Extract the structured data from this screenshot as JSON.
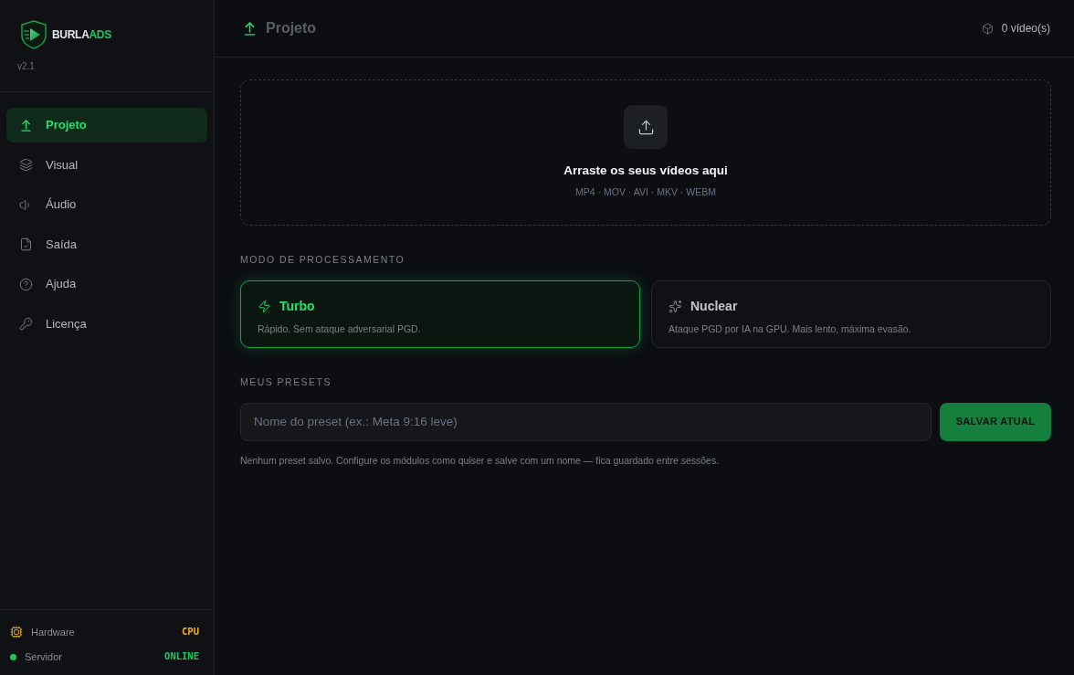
{
  "sidebar": {
    "brand": {
      "name_parts": [
        {
          "text": "BURLA",
          "color": "#e5e7eb"
        },
        {
          "text": "ADS",
          "color": "#22c55e"
        }
      ]
    },
    "version": "v2.1",
    "items": [
      {
        "label": "Projeto",
        "selected": true
      },
      {
        "label": "Visual",
        "selected": false
      },
      {
        "label": "Áudio",
        "selected": false
      },
      {
        "label": "Saída",
        "selected": false
      },
      {
        "label": "Ajuda",
        "selected": false
      },
      {
        "label": "Licença",
        "selected": false
      }
    ],
    "status": [
      {
        "kind": "icon",
        "label": "Hardware",
        "value": "CPU",
        "color": "#f5b324"
      },
      {
        "kind": "dot",
        "label": "Servidor",
        "value": "ONLINE",
        "color": "#22c55e"
      }
    ]
  },
  "header": {
    "title": "Projeto",
    "counter": "0 vídeo(s)"
  },
  "dropzone": {
    "title": "Arraste os seus vídeos aqui",
    "formats": "MP4 · MOV · AVI · MKV · WEBM"
  },
  "processing_mode": {
    "label": "MODO DE PROCESSAMENTO",
    "modes": [
      {
        "title": "Turbo",
        "description": "Rápido. Sem ataque adversarial PGD.",
        "selected": true
      },
      {
        "title": "Nuclear",
        "description": "Ataque PGD por IA na GPU. Mais lento, máxima evasão.",
        "selected": false
      }
    ]
  },
  "presets": {
    "label": "MEUS PRESETS",
    "input": {
      "placeholder": "Nome do preset (ex.: Meta 9:16 leve)"
    },
    "button": "SALVAR ATUAL",
    "empty_message": "Nenhum preset salvo. Configure os módulos como quiser e salve com um nome — fica guardado entre sessões."
  }
}
